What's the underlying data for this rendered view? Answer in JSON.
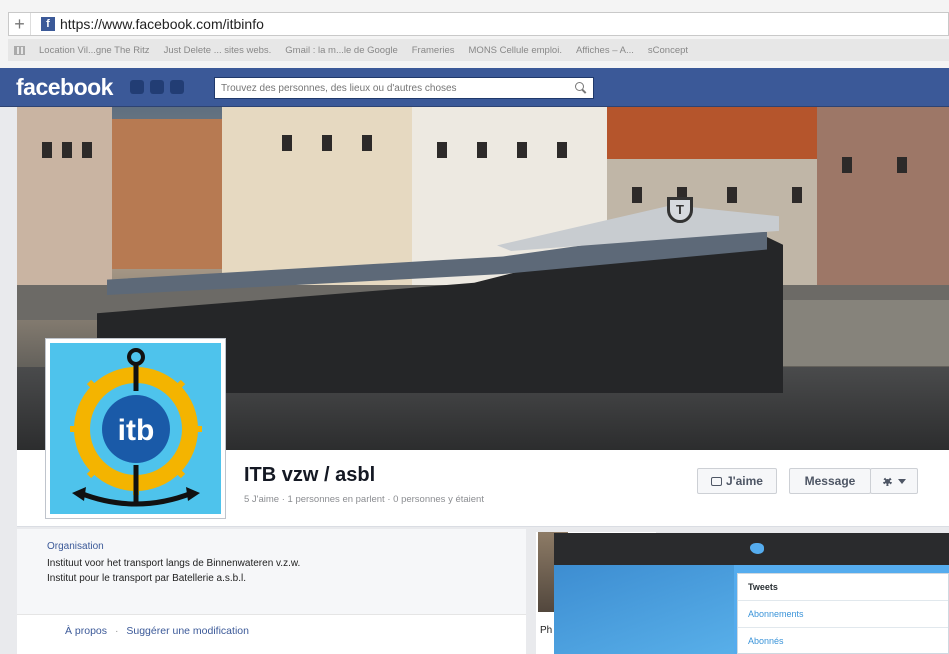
{
  "browser": {
    "url": "https://www.facebook.com/itbinfo",
    "bookmarks": [
      "Location Vil...gne The Ritz",
      "Just Delete ... sites webs.",
      "Gmail : la m...le de Google",
      "Frameries",
      "MONS Cellule emploi.",
      "Affiches – A...",
      "sConcept"
    ]
  },
  "facebook": {
    "logo": "facebook",
    "search_placeholder": "Trouvez des personnes, des lieux ou d'autres choses",
    "brand_color": "#3b5998"
  },
  "page": {
    "name": "ITB vzw / asbl",
    "stats": "5 J'aime · 1 personnes en parlent · 0 personnes y étaient",
    "like_button": "J'aime",
    "message_button": "Message",
    "bow_badge": "T",
    "avatar_text": "itb",
    "about": {
      "category": "Organisation",
      "lines": [
        "Instituut voor het transport langs de Binnenwateren v.z.w.",
        "Institut pour le transport par Batellerie a.s.b.l."
      ],
      "link_about": "À propos",
      "separator": "·",
      "link_suggest": "Suggérer une modification"
    },
    "photos_label": "Ph"
  },
  "twitter": {
    "items": [
      "Tweets",
      "Abonnements",
      "Abonnés"
    ],
    "accent": "#55acee"
  }
}
